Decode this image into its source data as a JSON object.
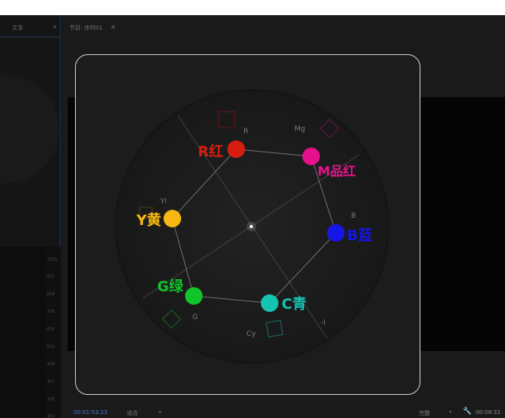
{
  "left_panel": {
    "tab_label": "文本",
    "more_label": "»"
  },
  "ruler": {
    "ticks": [
      "1023",
      "921",
      "818",
      "716",
      "614",
      "512",
      "409",
      "307",
      "205",
      "102"
    ]
  },
  "program_monitor": {
    "title": "节目: 序列01",
    "menu_label": "≡",
    "timecode": "00:01:53:23",
    "fit_label": "适合",
    "resolution_label": "完整",
    "duration": "00:08:31"
  },
  "vectorscope": {
    "targets": [
      {
        "code": "R",
        "name": "R红",
        "color": "#d61e10"
      },
      {
        "code": "Mg",
        "name": "M品红",
        "color": "#e8118d"
      },
      {
        "code": "B",
        "name": "B蓝",
        "color": "#1616e6"
      },
      {
        "code": "Cy",
        "name": "C青",
        "color": "#16c4b4"
      },
      {
        "code": "G",
        "name": "G绿",
        "color": "#10c42a"
      },
      {
        "code": "Yl",
        "name": "Y黄",
        "color": "#f8b812"
      }
    ],
    "extra_label": "-I"
  }
}
